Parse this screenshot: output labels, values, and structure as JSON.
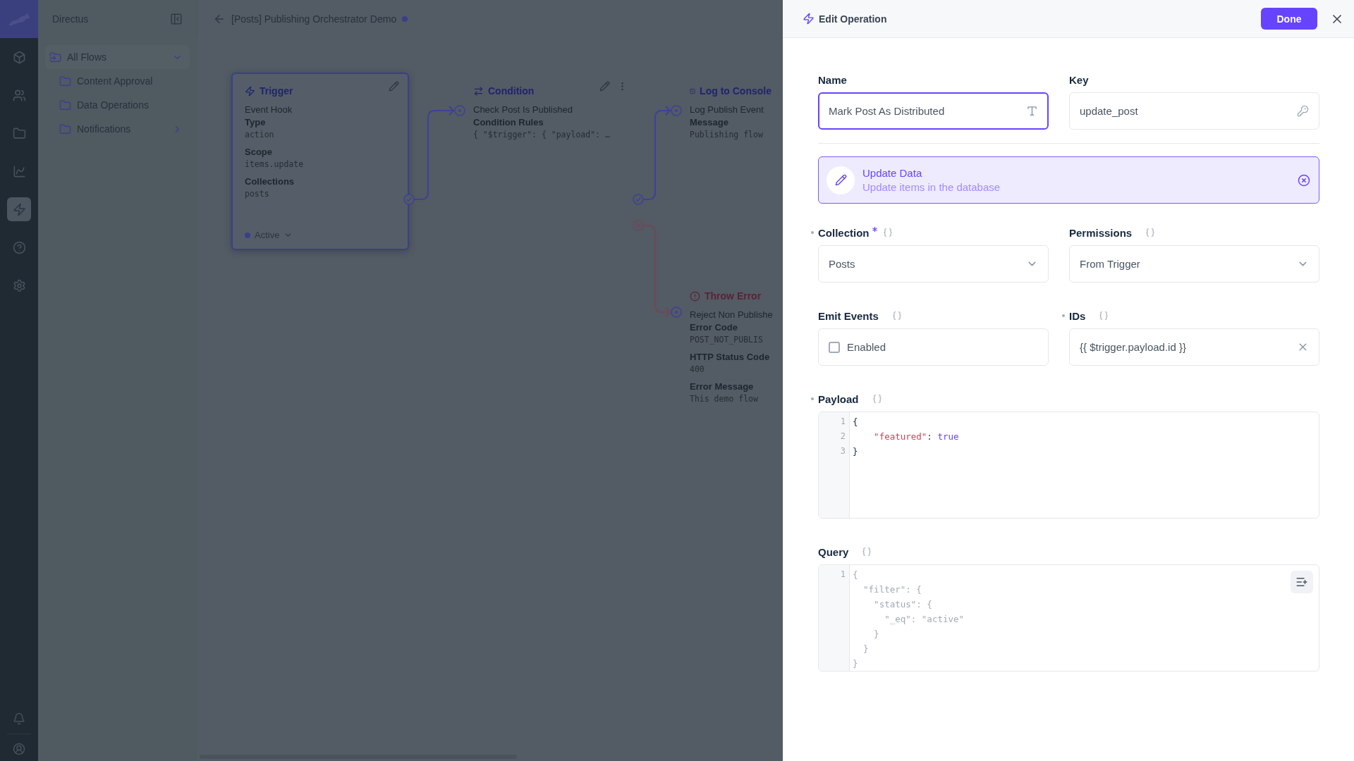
{
  "rail": {
    "items": [
      {
        "kind": "content",
        "selected": false
      },
      {
        "kind": "users",
        "selected": false
      },
      {
        "kind": "files",
        "selected": false
      },
      {
        "kind": "insights",
        "selected": false
      },
      {
        "kind": "flows",
        "selected": true
      },
      {
        "kind": "help",
        "selected": false
      },
      {
        "kind": "settings",
        "selected": false
      }
    ],
    "bottom": [
      {
        "kind": "notifications"
      },
      {
        "kind": "account"
      }
    ]
  },
  "sidebar": {
    "title": "Directus",
    "folders": [
      {
        "label": "All Flows",
        "expanded": true,
        "children": [
          {
            "label": "Content Approval",
            "has_subfolders": false
          },
          {
            "label": "Data Operations",
            "has_subfolders": false
          },
          {
            "label": "Notifications",
            "has_subfolders": true
          }
        ]
      }
    ]
  },
  "header": {
    "title": "[Posts] Publishing Orchestrator Demo",
    "unsaved": true
  },
  "flow": {
    "nodes": [
      {
        "kind": "trigger",
        "title": "Trigger",
        "subtitle": "Event Hook",
        "selected": true,
        "hovered": false,
        "fields": [
          {
            "label": "Type",
            "value": "action"
          },
          {
            "label": "Scope",
            "value": "items.update"
          },
          {
            "label": "Collections",
            "value": "posts"
          }
        ],
        "status": "Active"
      },
      {
        "kind": "condition",
        "title": "Condition",
        "subtitle": "Check Post Is Published",
        "selected": false,
        "hovered": true,
        "fields": [
          {
            "label": "Condition Rules",
            "value": "{ \"$trigger\": { \"payload\": …"
          }
        ]
      },
      {
        "kind": "log",
        "title": "Log to Console",
        "subtitle": "Log Publish Event",
        "selected": false,
        "hovered": false,
        "fields": [
          {
            "label": "Message",
            "value": "Publishing flow"
          }
        ]
      },
      {
        "kind": "error",
        "title": "Throw Error",
        "subtitle": "Reject Non Publishe",
        "selected": false,
        "hovered": false,
        "fields": [
          {
            "label": "Error Code",
            "value": "POST_NOT_PUBLIS"
          },
          {
            "label": "HTTP Status Code",
            "value": "400"
          },
          {
            "label": "Error Message",
            "value": "This demo flow"
          }
        ]
      }
    ]
  },
  "panel": {
    "title": "Edit Operation",
    "done": "Done",
    "identity": [
      {
        "kind": "text",
        "label": "Name",
        "value": "Mark Post As Distributed",
        "focused": true
      },
      {
        "kind": "key",
        "label": "Key",
        "value": "update_post",
        "focused": false
      }
    ],
    "operation": {
      "title": "Update Data",
      "description": "Update items in the database"
    },
    "fields": [
      {
        "kind": "select",
        "label": "Collection",
        "edited": true,
        "required": true,
        "value": "Posts"
      },
      {
        "kind": "select",
        "label": "Permissions",
        "edited": false,
        "required": false,
        "value": "From Trigger"
      },
      {
        "kind": "checkbox",
        "label": "Emit Events",
        "edited": false,
        "required": false,
        "option": "Enabled",
        "checked": false
      },
      {
        "kind": "input",
        "label": "IDs",
        "edited": true,
        "required": false,
        "value": "{{ $trigger.payload.id }}"
      },
      {
        "kind": "code",
        "label": "Payload",
        "edited": true,
        "required": false,
        "placeholder": false,
        "lines": [
          {
            "number": "1",
            "tokens": [
              {
                "text": "{"
              }
            ]
          },
          {
            "number": "2",
            "tokens": [
              {
                "color": "#d5425c",
                "text": "    \"featured\""
              },
              {
                "text": ": "
              },
              {
                "color": "#6644ff",
                "text": "true"
              }
            ]
          },
          {
            "number": "3",
            "tokens": [
              {
                "text": "}"
              }
            ]
          }
        ]
      },
      {
        "kind": "code",
        "label": "Query",
        "edited": false,
        "required": false,
        "placeholder": true,
        "lines": [
          {
            "number": "1",
            "tokens": [
              {
                "text": "{"
              }
            ]
          },
          {
            "tokens": [
              {
                "text": "  \"filter\": {"
              }
            ]
          },
          {
            "tokens": [
              {
                "text": "    \"status\": {"
              }
            ]
          },
          {
            "tokens": [
              {
                "text": "      \"_eq\": \"active\""
              }
            ]
          },
          {
            "tokens": [
              {
                "text": "    }"
              }
            ]
          },
          {
            "tokens": [
              {
                "text": "  }"
              }
            ]
          },
          {
            "tokens": [
              {
                "text": "}"
              }
            ]
          }
        ]
      }
    ]
  }
}
